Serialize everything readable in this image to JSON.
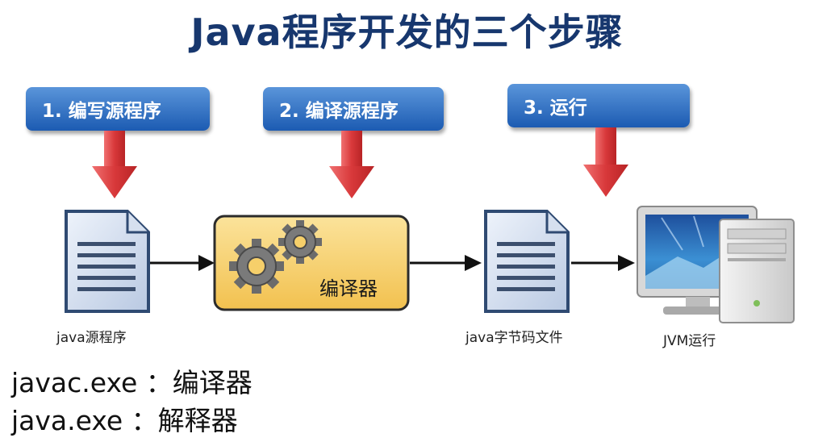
{
  "title": "Java程序开发的三个步骤",
  "steps": [
    {
      "label": "1. 编写源程序"
    },
    {
      "label": "2. 编译源程序"
    },
    {
      "label": "3. 运行"
    }
  ],
  "compiler_label": "编译器",
  "captions": {
    "source": "java源程序",
    "bytecode": "java字节码文件",
    "jvm": "JVM运行"
  },
  "notes": [
    "javac.exe ：编译器",
    "java.exe ：解释器"
  ],
  "colors": {
    "title": "#17376e",
    "step_box": "#2a6cc4",
    "arrow_red": "#d8383a",
    "compiler_box": "#f6cf6a"
  }
}
